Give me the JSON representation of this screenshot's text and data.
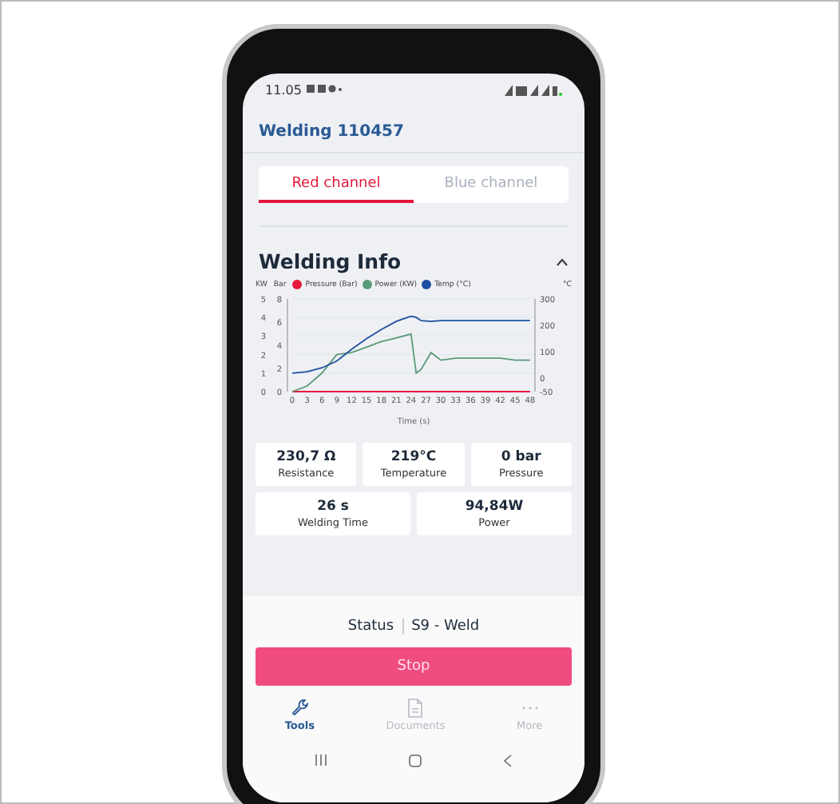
{
  "status_bar": {
    "time": "11.05"
  },
  "header": {
    "title": "Welding 110457"
  },
  "tabs": [
    {
      "label": "Red channel",
      "selected": true
    },
    {
      "label": "Blue channel",
      "selected": false
    }
  ],
  "section": {
    "title": "Welding Info",
    "expanded": true
  },
  "chart": {
    "units_left": [
      "KW",
      "Bar"
    ],
    "unit_right": "°C",
    "chart_data": {
      "type": "line",
      "xlabel": "Time (s)",
      "x": [
        0,
        3,
        6,
        9,
        12,
        15,
        18,
        21,
        24,
        25,
        26,
        28,
        30,
        33,
        36,
        39,
        42,
        45,
        48
      ],
      "xticks": [
        0,
        3,
        6,
        9,
        12,
        15,
        18,
        21,
        24,
        27,
        30,
        33,
        36,
        39,
        42,
        45,
        48
      ],
      "yticks": [
        0,
        1,
        2,
        3,
        4,
        5
      ],
      "ylim": [
        0,
        5
      ],
      "y2ticks": [
        0,
        2,
        4,
        6,
        8
      ],
      "y2lim": [
        0,
        8
      ],
      "y3ticks": [
        -50,
        0,
        100,
        200,
        300
      ],
      "y3lim": [
        -50,
        300
      ],
      "xlim": [
        0,
        49
      ],
      "grid": true,
      "legend": "top",
      "series": [
        {
          "name": "Pressure (Bar)",
          "color": "#e8193c",
          "axis": "y2",
          "values": [
            0,
            0,
            0,
            0,
            0,
            0,
            0,
            0,
            0,
            0,
            0,
            0,
            0,
            0,
            0,
            0,
            0,
            0,
            0
          ]
        },
        {
          "name": "Power (KW)",
          "color": "#5b9a78",
          "values": [
            0,
            0.3,
            1.0,
            2.0,
            2.1,
            2.4,
            2.7,
            2.9,
            3.1,
            1.0,
            1.2,
            2.1,
            1.7,
            1.8,
            1.8,
            1.8,
            1.8,
            1.7,
            1.7
          ]
        },
        {
          "name": "Temp (°C)",
          "color": "#1f4fa0",
          "axis": "y3",
          "values": [
            20,
            25,
            40,
            65,
            110,
            150,
            185,
            215,
            235,
            230,
            218,
            215,
            218,
            218,
            218,
            218,
            218,
            218,
            218
          ]
        }
      ]
    }
  },
  "stats": [
    {
      "value": "230,7 Ω",
      "label": "Resistance"
    },
    {
      "value": "219°C",
      "label": "Temperature"
    },
    {
      "value": "0 bar",
      "label": "Pressure"
    },
    {
      "value": "26 s",
      "label": "Welding Time"
    },
    {
      "value": "94,84W",
      "label": "Power"
    }
  ],
  "status": {
    "label": "Status",
    "value": "S9 - Weld"
  },
  "stop_button": "Stop",
  "nav": [
    {
      "kind": "tools",
      "label": "Tools",
      "selected": true
    },
    {
      "kind": "documents",
      "label": "Documents",
      "selected": false
    },
    {
      "kind": "more",
      "label": "More",
      "selected": false
    }
  ]
}
